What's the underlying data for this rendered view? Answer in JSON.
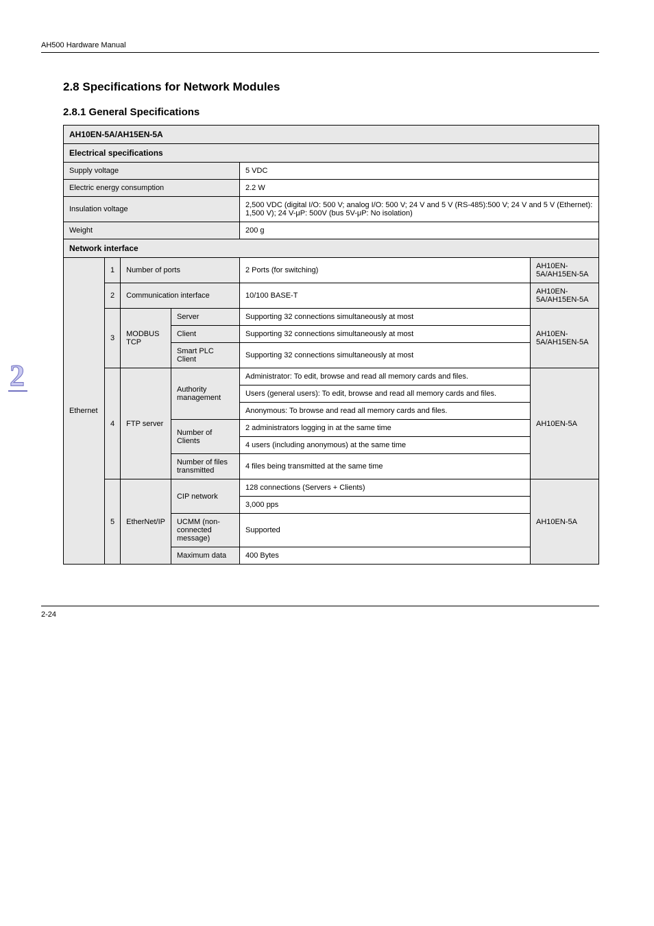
{
  "header": {
    "left": "AH500 Hardware Manual",
    "right": ""
  },
  "section_title": "2.8 Specifications for Network Modules",
  "subsection_title": "2.8.1 General Specifications",
  "table": {
    "title1": "AH10EN-5A/AH15EN-5A",
    "title2": "Electrical specifications",
    "rows": [
      {
        "label_span": 4,
        "label": "Supply voltage",
        "value_span": 2,
        "value": "5 VDC"
      },
      {
        "label_span": 4,
        "label": "Electric energy consumption",
        "value_span": 2,
        "value": "2.2 W"
      },
      {
        "label_span": 4,
        "label": "Insulation voltage",
        "value_span": 2,
        "value": "2,500 VDC (digital I/O: 500 V; analog I/O: 500 V; 24 V and 5 V (RS-485):500 V; 24 V and 5 V (Ethernet): 1,500 V); 24 V-μP: 500V (bus 5V-μP: No isolation)"
      },
      {
        "label_span": 4,
        "label": "Weight",
        "value_span": 2,
        "value": "200 g"
      }
    ],
    "netif_title": "Network interface",
    "netif": {
      "first_col": "Ethernet",
      "rows": [
        {
          "c2": "1",
          "c3_span": 2,
          "c3": "Number of ports",
          "val": "2 Ports (for switching)",
          "rcol": "AH10EN-5A/AH15EN-5A"
        },
        {
          "c2": "2",
          "c3_span": 2,
          "c3": "Communication interface",
          "val": "10/100 BASE-T",
          "rcol": "AH10EN-5A/AH15EN-5A"
        },
        {
          "c2": "3",
          "c3_rowspan": 3,
          "c3": "MODBUS TCP",
          "c4": "Server",
          "val": "Supporting 32 connections simultaneously at most",
          "rcol_rowspan": 3,
          "rcol": "AH10EN-5A/AH15EN-5A"
        },
        {
          "c4": "Client",
          "val": "Supporting 32 connections simultaneously at most"
        },
        {
          "c4": "Smart PLC Client",
          "val": "Supporting 32 connections simultaneously at most"
        },
        {
          "c2": "4",
          "c3_rowspan": 5,
          "c3": "FTP server",
          "c4_rowspan": 3,
          "c4": "Authority management",
          "val": "Administrator: To edit, browse and read all memory cards and files.",
          "rcol_rowspan": 5,
          "rcol": "AH10EN-5A"
        },
        {
          "val": "Users (general users): To edit, browse and read all memory cards and files."
        },
        {
          "val": "Anonymous: To browse and read all memory cards and files."
        },
        {
          "c4_rowspan": 2,
          "c4": "Number of Clients",
          "val": "2 administrators logging in at the same time"
        },
        {
          "val": "4 users (including anonymous) at the same time"
        },
        {
          "c4b": "Number of files transmitted",
          "valb": "4 files being transmitted at the same time"
        },
        {
          "c2": "5",
          "c3_rowspan": 4,
          "c3": "EtherNet/IP",
          "c4_rowspan": 2,
          "c4": "CIP network",
          "val": "128 connections (Servers + Clients)",
          "rcol_rowspan": 4,
          "rcol": "AH10EN-5A"
        },
        {
          "val": "3,000 pps"
        },
        {
          "c4": "UCMM (non-connected message)",
          "val": "Supported"
        },
        {
          "c4": "Maximum data",
          "val": "400 Bytes"
        }
      ]
    }
  },
  "footer": {
    "left": "2-24",
    "right": ""
  }
}
